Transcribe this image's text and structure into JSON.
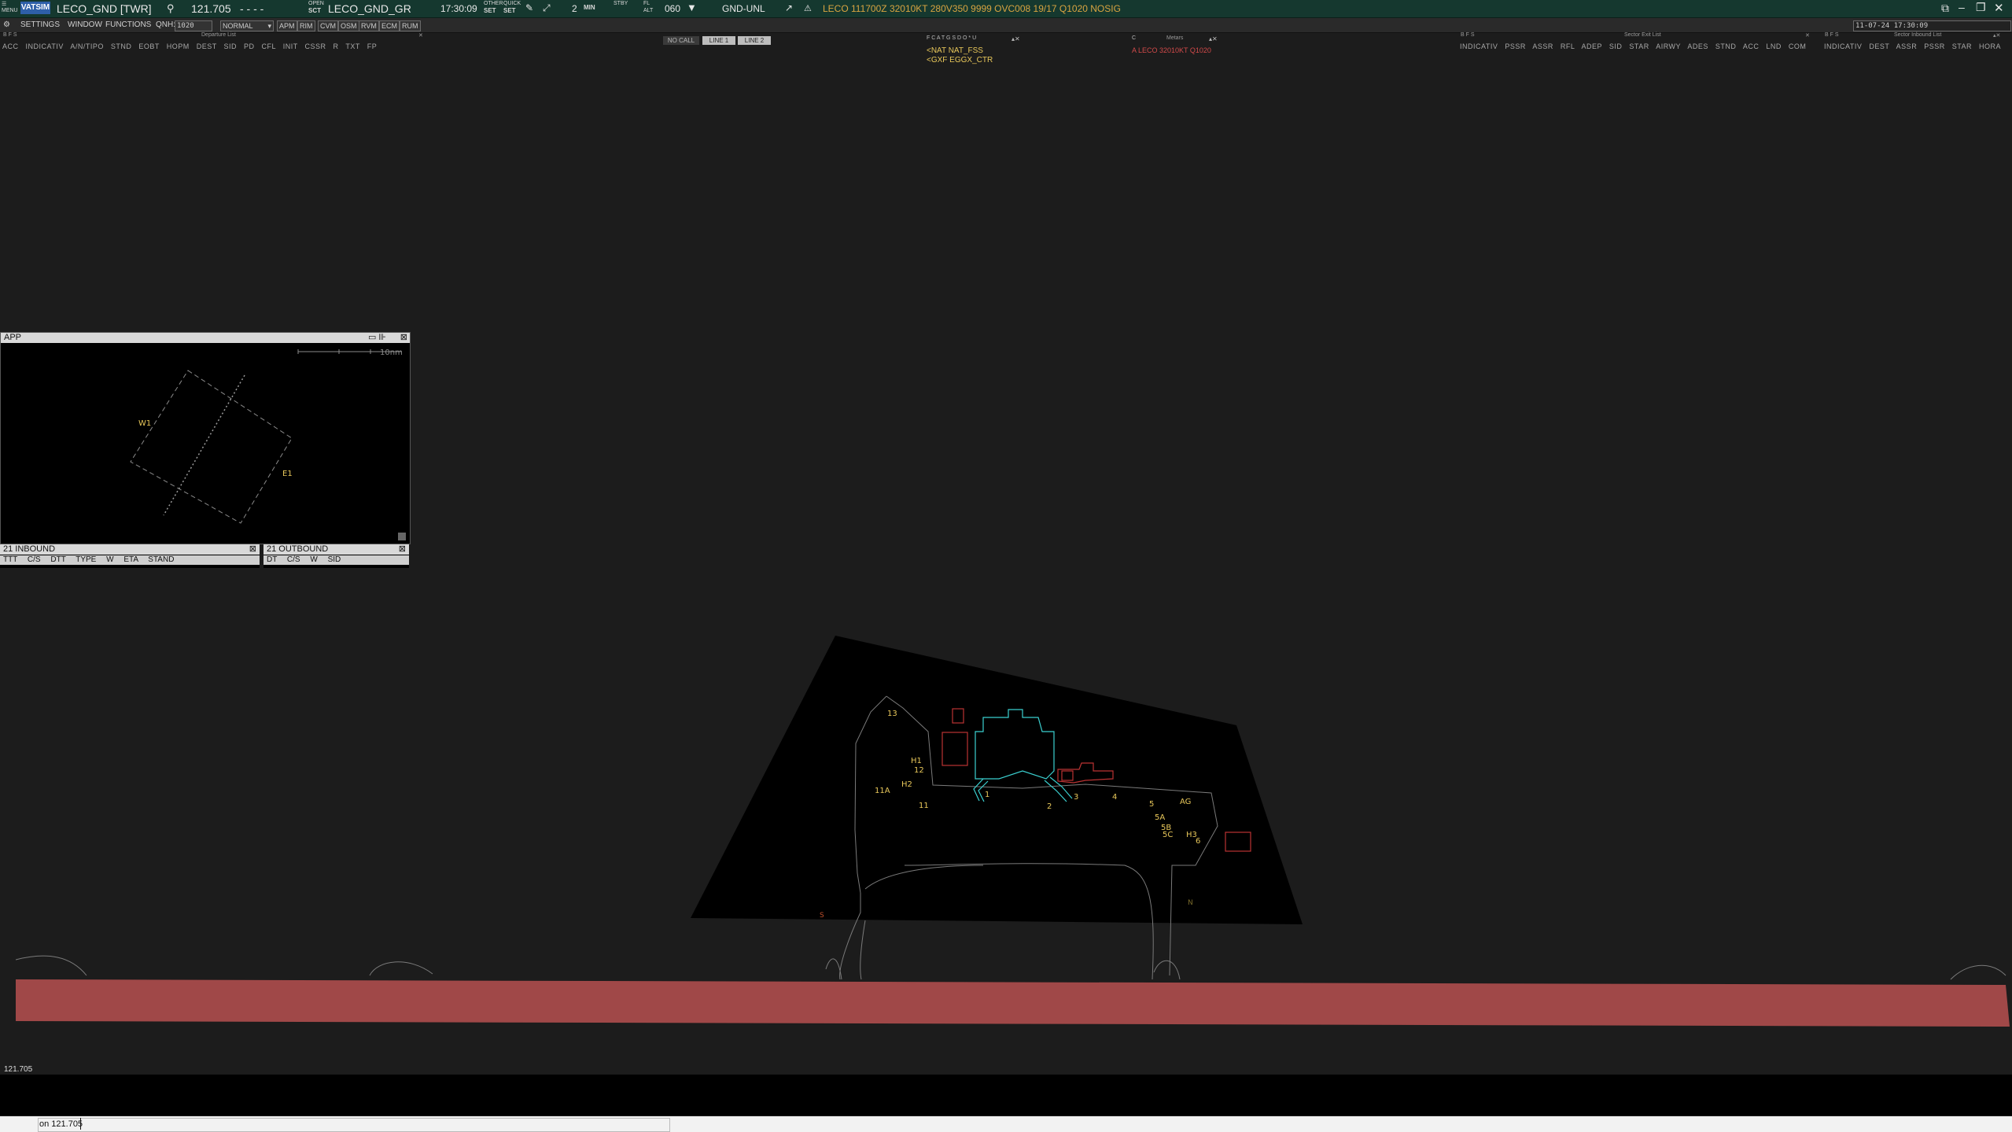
{
  "topbar": {
    "logo": "VATSIM",
    "position": "LECO_GND [TWR]",
    "frequency": "121.705",
    "dashes": "-  -  -  -",
    "open_label": "OPEN",
    "sct_label": "SCT",
    "sector": "LECO_GND_GR",
    "clock": "17:30:09",
    "other_label": "OTHER",
    "quick_label": "QUICK",
    "set1": "SET",
    "set2": "SET",
    "min_value": "2",
    "min_label": "MIN",
    "stby_label": "STBY",
    "fl_label": "FL",
    "alt_label": "ALT",
    "level": "060",
    "mode": "GND-UNL",
    "metar": "LECO 111700Z 32010KT 280V350 9999 OVC008 19/17 Q1020 NOSIG",
    "colors": {
      "bar": "#15382f",
      "metar": "#d9a441"
    }
  },
  "menubar": {
    "items": [
      "SETTINGS",
      "WINDOW",
      "FUNCTIONS"
    ],
    "qnh_label": "QNH:",
    "qnh_value": "1020",
    "mode": "NORMAL",
    "buttons": [
      "APM",
      "RIM",
      "CVM",
      "OSM",
      "RVM",
      "ECM",
      "RUM"
    ],
    "date_time": "11-07-24 17:30:09"
  },
  "departure_list": {
    "title": "Departure List",
    "icons": "B F S",
    "columns": "ACC INDICATIV A/N/TIPO STND EOBT HOPM DEST SID PD CFL INIT CSSR R TXT FP"
  },
  "call_bar": {
    "no_call": "NO CALL",
    "line1": "LINE 1",
    "line2": "LINE 2"
  },
  "atc_list": {
    "header": "F C A T G S D O * U",
    "entries": [
      "<NAT NAT_FSS",
      "<GXF EGGX_CTR"
    ]
  },
  "metars_window": {
    "title": "Metars",
    "c_label": "C",
    "entry": "A LECO 32010KT Q1020"
  },
  "sector_exit_list": {
    "title": "Sector Exit List",
    "icons": "B F S",
    "columns": "INDICATIV PSSR ASSR RFL ADEP SID STAR AIRWY ADES STND ACC LND COM"
  },
  "sector_inbound_list": {
    "title": "Sector Inbound List",
    "icons": "B F S",
    "columns": "INDICATIV DEST ASSR PSSR STAR HORA"
  },
  "app_window": {
    "title": "APP",
    "scale": "10nm",
    "labels": [
      "W1",
      "E1"
    ]
  },
  "inbound": {
    "title": "21 INBOUND",
    "columns": "TTT C/S DTT TYPE W ETA STAND"
  },
  "outbound": {
    "title": "21 OUTBOUND",
    "columns": "DT C/S W SID"
  },
  "apron_labels": [
    "13",
    "H1",
    "12",
    "H2",
    "11A",
    "11",
    "1",
    "2",
    "3",
    "4",
    "5",
    "5A",
    "5B",
    "5C",
    "AG",
    "H3",
    "6",
    "S",
    "N"
  ],
  "bottom": {
    "frequency": "121.705",
    "command_text": "on 121.705"
  }
}
